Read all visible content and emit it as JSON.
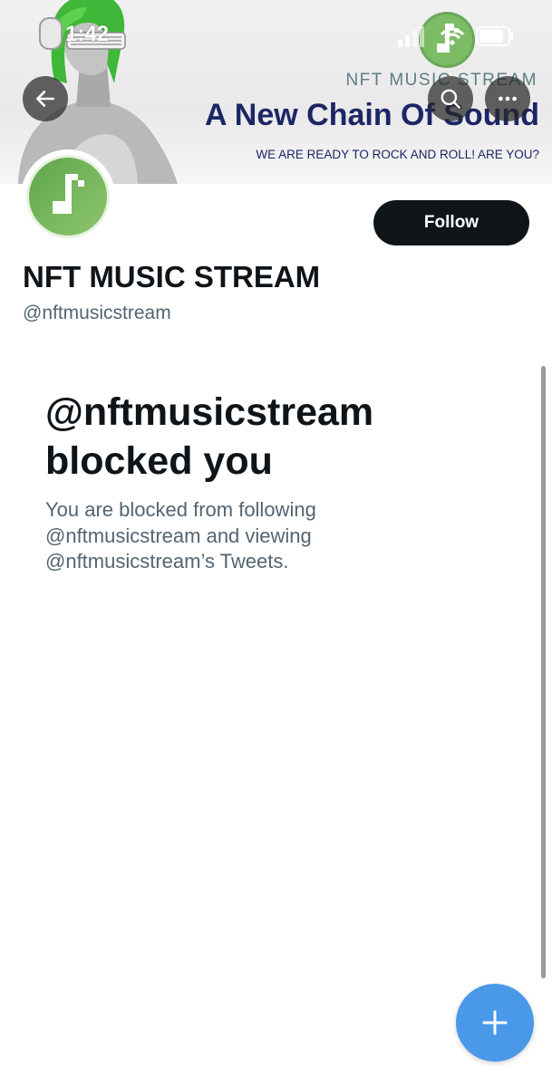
{
  "status_bar": {
    "time": "1:42"
  },
  "banner": {
    "brand_text": "NFT MUSIC STREAM",
    "headline": "A New Chain Of Sound",
    "tagline": "WE ARE READY TO ROCK AND ROLL! ARE YOU?"
  },
  "header": {
    "back_icon": "arrow-left-icon",
    "search_icon": "search-icon",
    "more_icon": "more-horizontal-icon"
  },
  "profile": {
    "display_name": "NFT MUSIC STREAM",
    "handle": "@nftmusicstream",
    "follow_label": "Follow",
    "avatar_icon": "music-note-icon"
  },
  "blocked": {
    "title_line1": "@nftmusicstream",
    "title_line2": "blocked you",
    "description": "You are blocked from following @nftmusicstream and viewing @nftmusicstream’s Tweets."
  },
  "fab": {
    "icon": "plus-icon"
  },
  "colors": {
    "accent": "#4a99e9",
    "text_primary": "#0f1419",
    "text_secondary": "#536471",
    "brand_green": "#6fae5a",
    "headline_navy": "#1c2566"
  }
}
